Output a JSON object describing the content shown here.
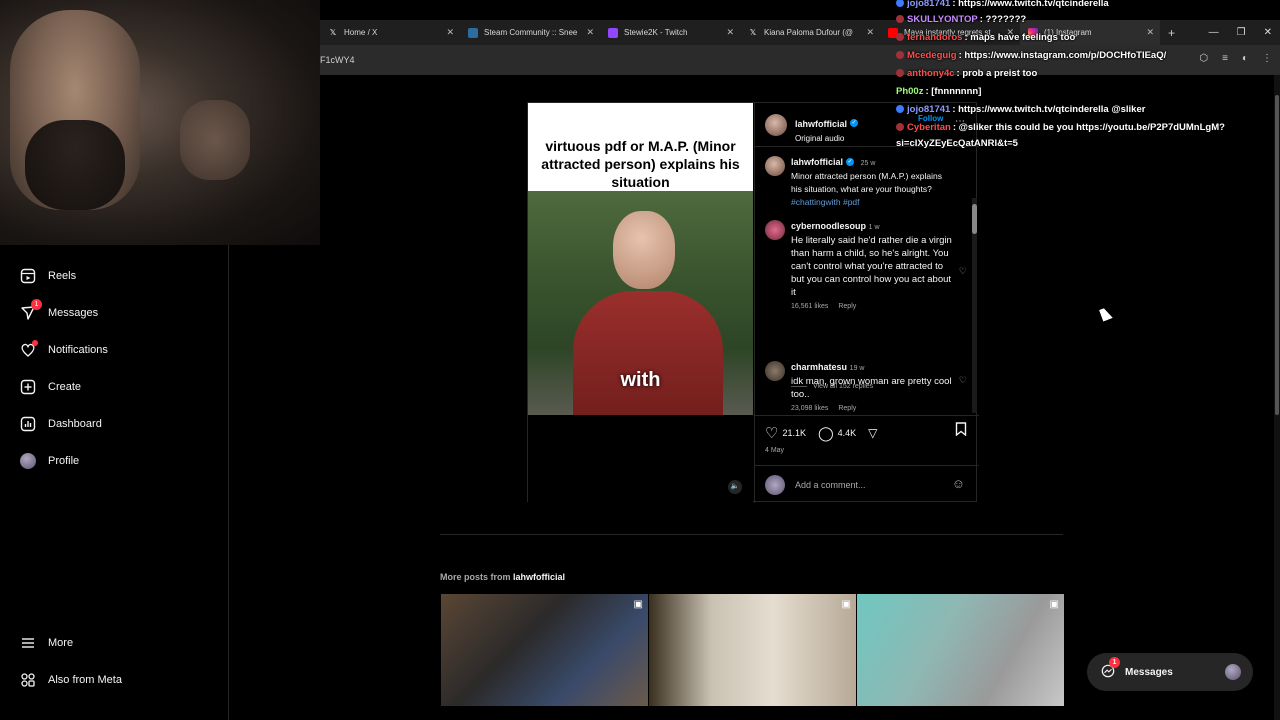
{
  "browser": {
    "tabs": [
      {
        "label": "Home / X",
        "icon": "x-icon",
        "active": false
      },
      {
        "label": "Steam Community :: Snee",
        "icon": "steam-icon",
        "active": false
      },
      {
        "label": "Stewie2K - Twitch",
        "icon": "twitch-icon",
        "active": false
      },
      {
        "label": "Kiana Paloma Dufour (@",
        "icon": "x-icon",
        "active": false
      },
      {
        "label": "Maya instantly regrets st",
        "icon": "youtube-icon",
        "active": false
      },
      {
        "label": "(1) Instagram",
        "icon": "instagram-icon",
        "active": true
      }
    ],
    "address": "F1cWY4"
  },
  "sidebar": {
    "items": [
      {
        "label": "Reels",
        "icon": "reels-icon"
      },
      {
        "label": "Messages",
        "icon": "messages-icon",
        "badge": "1"
      },
      {
        "label": "Notifications",
        "icon": "heart-icon"
      },
      {
        "label": "Create",
        "icon": "plus-icon"
      },
      {
        "label": "Dashboard",
        "icon": "dashboard-icon"
      },
      {
        "label": "Profile",
        "icon": "avatar"
      }
    ],
    "more": "More",
    "meta": "Also from Meta"
  },
  "post": {
    "overlay_title": "virtuous pdf or M.A.P. (Minor attracted person) explains his situation",
    "subtitle_word": "with",
    "author": "lahwfofficial",
    "audio": "Original audio",
    "follow": "Follow",
    "caption": {
      "user": "lahwfofficial",
      "time": "25 w",
      "text": "Minor attracted person (M.A.P.) explains his situation, what are your thoughts?",
      "tags": "#chattingwith #pdf"
    },
    "comments": [
      {
        "user": "cybernoodlesoup",
        "time": "1 w",
        "text": "He literally said he'd rather die a virgin than harm a child, so he's alright. You can't control what you're attracted to but you can control how you act about it",
        "likes": "16,561 likes",
        "reply": "Reply"
      },
      {
        "user": "charmhatesu",
        "time": "19 w",
        "text": "idk man, grown woman are pretty cool too..",
        "likes": "23,098 likes",
        "reply": "Reply"
      }
    ],
    "view_replies": "View all 152 replies",
    "like_count": "21.1K",
    "comment_count": "4.4K",
    "date": "4 May",
    "add_comment_placeholder": "Add a comment..."
  },
  "more_posts": {
    "label": "More posts from",
    "user": "lahwfofficial"
  },
  "messages_pill": {
    "label": "Messages",
    "badge": "1"
  },
  "chat": [
    {
      "user": "jojo81741",
      "text": ": https://www.twitch.tv/qtcinderella",
      "color": "#8a9cff"
    },
    {
      "user": "SKULLYONTOP",
      "text": ": ???????",
      "color": "#c889ff"
    },
    {
      "user": "fernandoros",
      "text": ": maps have feelings too",
      "color": "#ff4d4d"
    },
    {
      "user": "Mcedeguig",
      "text": ": https://www.instagram.com/p/DOCHfoTIEaQ/",
      "color": "#ff4d4d"
    },
    {
      "user": "anthony4c",
      "text": ": prob a preist too",
      "color": "#ff4d4d"
    },
    {
      "user": "Ph00z",
      "text": ": [fnnnnnnn]",
      "color": "#9cff7a"
    },
    {
      "user": "jojo81741",
      "text": ": https://www.twitch.tv/qtcinderella @sliker",
      "color": "#8a9cff"
    },
    {
      "user": "Cyberitan",
      "text": ": @sliker this could be you https://youtu.be/P2P7dUMnLgM?",
      "color": "#ff4d4d"
    },
    {
      "user": "",
      "text": "si=cIXyZEyEcQatANRI&t=5",
      "color": "#ffffff"
    }
  ]
}
